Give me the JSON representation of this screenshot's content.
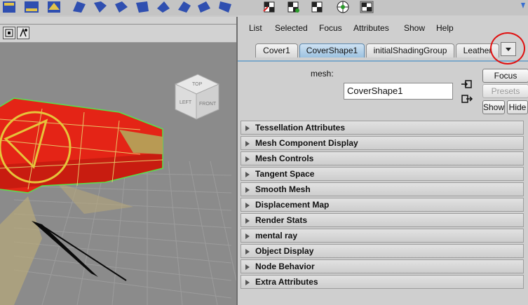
{
  "colors": {
    "viewport_bg": "#8b8b8b",
    "mesh_red": "#e42416",
    "wireframe_green": "#58e24a",
    "active_tab": "#9cc2e0",
    "annotation_red": "#e01010"
  },
  "shelf": {
    "icons": [
      "polygon-cube-icon",
      "polygon-sphere-icon",
      "polygon-plane-icon",
      "extrude-icon",
      "bevel-icon",
      "split-icon",
      "merge-icon",
      "smooth-icon",
      "bridge-icon",
      "sculpt-icon",
      "crease-icon",
      "uv-icon",
      "checker-icon",
      "checker-icon",
      "checker-icon",
      "sphere-icon",
      "checker-icon"
    ]
  },
  "viewport": {
    "view_cube": {
      "top_label": "TOP",
      "left_label": "LEFT",
      "front_label": "FRONT"
    }
  },
  "attribute_editor": {
    "menu": [
      "List",
      "Selected",
      "Focus",
      "Attributes",
      "Show",
      "Help"
    ],
    "tabs": [
      {
        "label": "Cover1",
        "active": false
      },
      {
        "label": "CoverShape1",
        "active": true
      },
      {
        "label": "initialShadingGroup",
        "active": false
      },
      {
        "label": "Leather",
        "active": false
      }
    ],
    "mesh_label": "mesh:",
    "mesh_value": "CoverShape1",
    "buttons": {
      "focus": "Focus",
      "presets": "Presets",
      "show": "Show",
      "hide": "Hide"
    },
    "sections": [
      "Tessellation Attributes",
      "Mesh Component Display",
      "Mesh Controls",
      "Tangent Space",
      "Smooth Mesh",
      "Displacement Map",
      "Render Stats",
      "mental ray",
      "Object Display",
      "Node Behavior",
      "Extra Attributes"
    ]
  }
}
